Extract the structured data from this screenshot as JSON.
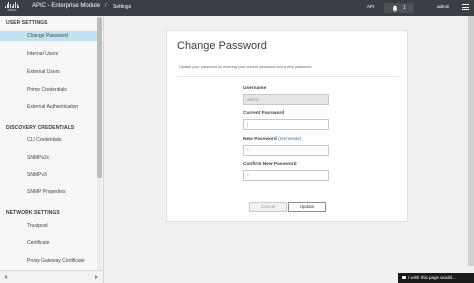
{
  "header": {
    "logo_text": "cisco",
    "app_title": "APIC - Enterprise Module",
    "breadcrumb_separator": "/",
    "breadcrumb": "Settings",
    "api_link": "API",
    "notification_count": "1",
    "user": "admin"
  },
  "sidebar": {
    "sections": [
      {
        "title": "USER SETTINGS",
        "items": [
          "Change Password",
          "Internal Users",
          "External Users",
          "Prime Credentials",
          "External Authentication"
        ]
      },
      {
        "title": "DISCOVERY CREDENTIALS",
        "items": [
          "CLI Credentials",
          "SNMPv2c",
          "SNMPv3",
          "SNMP Properties"
        ]
      },
      {
        "title": "NETWORK SETTINGS",
        "items": [
          "Trustpool",
          "Certificate",
          "Proxy Gateway Certificate"
        ]
      }
    ],
    "active_item": "Change Password"
  },
  "form": {
    "title": "Change Password",
    "subtitle": "Update your password by entering your current password and a new password.",
    "username_label": "Username",
    "username_value": "admin",
    "current_label": "Current Password",
    "current_value": "|",
    "new_label": "New Password",
    "generate_link": "(Generate)",
    "new_value": "*",
    "confirm_label": "Confirm New Password",
    "confirm_value": "*",
    "cancel_label": "Cancel",
    "update_label": "Update"
  },
  "feedback_label": "I wish this page would...",
  "colors": {
    "topbar": "#3b3f45",
    "active_item": "#bfe3f0",
    "link": "#1f7bb6"
  }
}
